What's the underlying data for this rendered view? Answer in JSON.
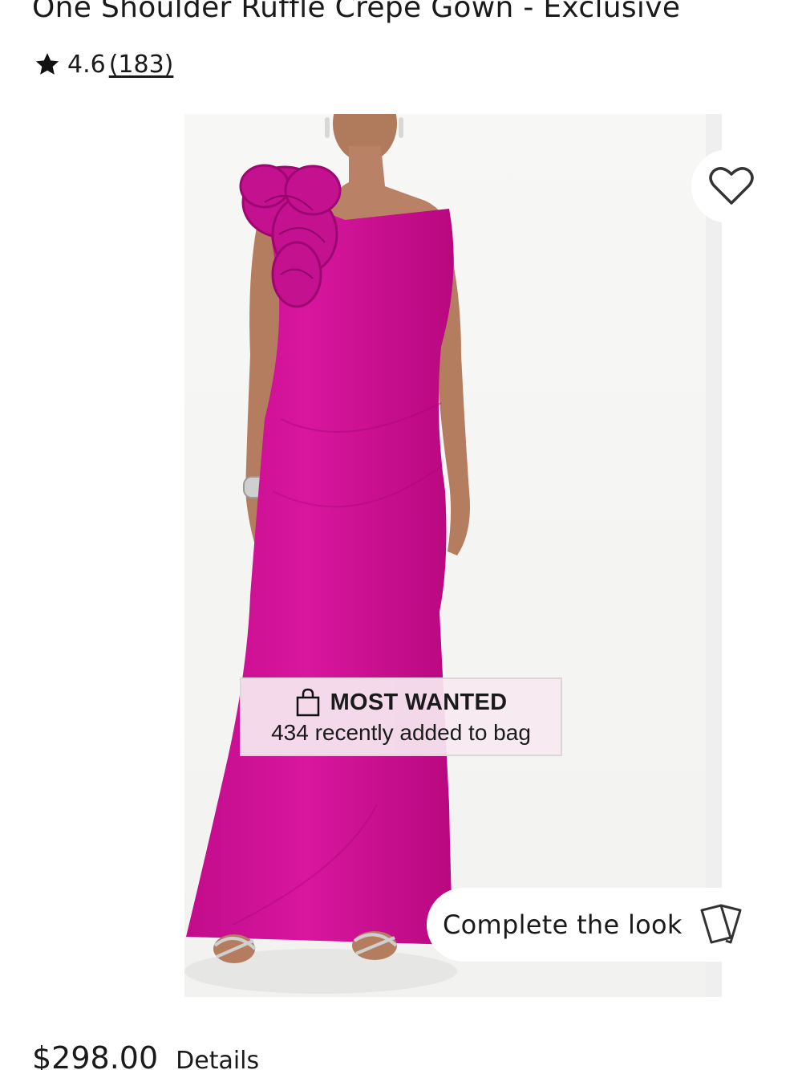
{
  "product": {
    "title": "One Shoulder Ruffle Crepe Gown - Exclusive",
    "rating": "4.6",
    "review_count": "(183)",
    "price": "$298.00",
    "details_label": "Details"
  },
  "badge": {
    "heading": "MOST WANTED",
    "subtext": "434 recently added to bag",
    "icon": "shopping-bag-icon"
  },
  "actions": {
    "wishlist_icon": "heart-icon",
    "complete_look_label": "Complete the look",
    "complete_look_icon": "cards-icon"
  },
  "colors": {
    "dress": "#d4149b",
    "text": "#1a1a1a",
    "badge_bg": "#f6e8f0"
  }
}
